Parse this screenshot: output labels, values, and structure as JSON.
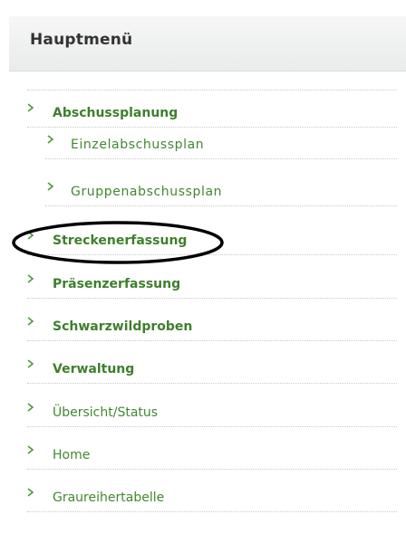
{
  "header": {
    "title": "Hauptmenü"
  },
  "menu": [
    {
      "label": "Abschussplanung",
      "level": 0,
      "style": "bold"
    },
    {
      "label": "Einzelabschussplan",
      "level": 1,
      "style": "sub"
    },
    {
      "label": "Gruppenabschussplan",
      "level": 1,
      "style": "sub"
    },
    {
      "label": "Streckenerfassung",
      "level": 0,
      "style": "bold"
    },
    {
      "label": "Präsenzerfassung",
      "level": 0,
      "style": "bold"
    },
    {
      "label": "Schwarzwildproben",
      "level": 0,
      "style": "bold"
    },
    {
      "label": "Verwaltung",
      "level": 0,
      "style": "bold"
    },
    {
      "label": "Übersicht/Status",
      "level": 0,
      "style": "normal"
    },
    {
      "label": "Home",
      "level": 0,
      "style": "normal"
    },
    {
      "label": "Graureihertabelle",
      "level": 0,
      "style": "normal"
    }
  ],
  "colors": {
    "accent": "#3e7f2c",
    "arrow": "#4a9a36",
    "annotation": "#000000"
  },
  "icons": {
    "bullet": "triangle-arrow-icon"
  }
}
